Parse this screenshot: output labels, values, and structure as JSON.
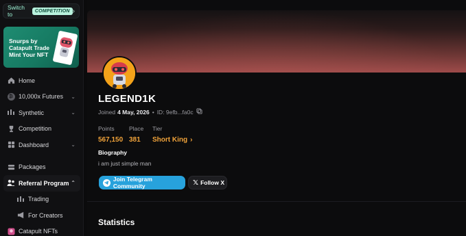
{
  "sidebar": {
    "switch_prefix": "Switch to",
    "switch_badge": "COMPETITION",
    "promo_line1": "Snurps by",
    "promo_line2": "Catapult Trade",
    "promo_line3": "Mint Your NFT",
    "items": [
      {
        "label": "Home",
        "icon": "home-icon"
      },
      {
        "label": "10,000x Futures",
        "icon": "bitcoin-icon"
      },
      {
        "label": "Synthetic",
        "icon": "synthetic-icon"
      },
      {
        "label": "Competition",
        "icon": "trophy-icon"
      },
      {
        "label": "Dashboard",
        "icon": "dashboard-icon"
      },
      {
        "label": "Packages",
        "icon": "packages-icon"
      },
      {
        "label": "Referral Program",
        "icon": "users-icon"
      },
      {
        "label": "Trading",
        "icon": "trading-icon"
      },
      {
        "label": "For Creators",
        "icon": "megaphone-icon"
      },
      {
        "label": "Catapult NFTs",
        "icon": "nft-icon"
      }
    ]
  },
  "profile": {
    "username": "LEGEND1K",
    "joined_prefix": "Joined",
    "joined_date": "4 May, 2026",
    "id_text": "ID: 9efb...fa0c",
    "points_label": "Points",
    "points_value": "567,150",
    "place_label": "Place",
    "place_value": "381",
    "tier_label": "Tier",
    "tier_value": "Short King",
    "bio_title": "Biography",
    "bio_text": "i am just simple man",
    "telegram_button": "Join Telegram Community",
    "x_button": "Follow X",
    "statistics_title": "Statistics"
  },
  "colors": {
    "accent_orange": "#f1a33a",
    "telegram_blue": "#27a2dc",
    "mint": "#b8f2dd"
  }
}
